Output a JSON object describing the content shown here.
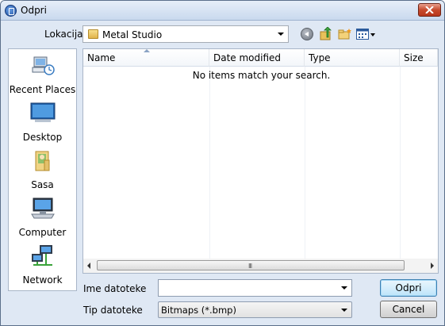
{
  "window": {
    "title": "Odpri"
  },
  "toolbar": {
    "location_label": "Lokacija",
    "location_value": "Metal Studio"
  },
  "places": [
    {
      "label": "Recent Places",
      "icon": "recent-places-icon"
    },
    {
      "label": "Desktop",
      "icon": "desktop-icon"
    },
    {
      "label": "Sasa",
      "icon": "user-folder-icon"
    },
    {
      "label": "Computer",
      "icon": "computer-icon"
    },
    {
      "label": "Network",
      "icon": "network-icon"
    }
  ],
  "filelist": {
    "columns": [
      "Name",
      "Date modified",
      "Type",
      "Size"
    ],
    "empty_message": "No items match your search.",
    "scroll_grip": "III"
  },
  "fields": {
    "filename_label": "Ime datoteke",
    "filename_value": "",
    "filetype_label": "Tip datoteke",
    "filetype_value": "Bitmaps (*.bmp)"
  },
  "buttons": {
    "open": "Odpri",
    "cancel": "Cancel"
  }
}
